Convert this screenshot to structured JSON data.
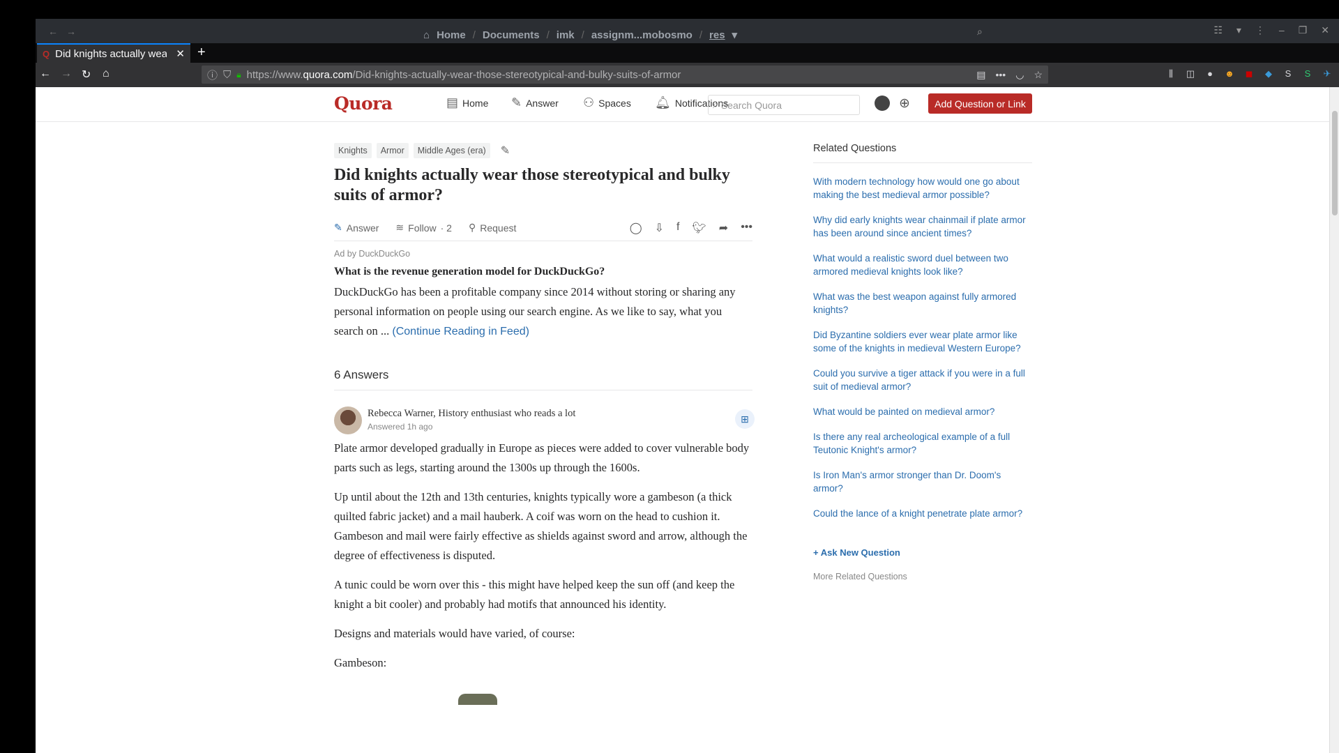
{
  "os_bar": {
    "crumbs": [
      "Home",
      "Documents",
      "imk",
      "assignm...mobosmo",
      "res"
    ]
  },
  "browser": {
    "tab_title": "Did knights actually wear those stereotypical and bulky suits of armor",
    "url_prefix": "https://www.",
    "url_domain": "quora.com",
    "url_path": "/Did-knights-actually-wear-those-stereotypical-and-bulky-suits-of-armor"
  },
  "header": {
    "logo": "Quora",
    "nav": [
      "Home",
      "Answer",
      "Spaces",
      "Notifications"
    ],
    "search_placeholder": "Search Quora",
    "add_button": "Add Question or Link"
  },
  "question": {
    "topics": [
      "Knights",
      "Armor",
      "Middle Ages (era)"
    ],
    "title": "Did knights actually wear those stereotypical and bulky suits of armor?",
    "answer_label": "Answer",
    "follow_label": "Follow",
    "follow_count": "· 2",
    "request_label": "Request"
  },
  "ad": {
    "by": "Ad by DuckDuckGo",
    "question": "What is the revenue generation model for DuckDuckGo?",
    "body": "DuckDuckGo has been a profitable company since 2014 without storing or sharing any personal information on people using our search engine. As we like to say, what you search on ... ",
    "link": "(Continue Reading in Feed)"
  },
  "answers": {
    "count_label": "6 Answers",
    "first": {
      "author": "Rebecca Warner, History enthusiast who reads a lot",
      "when": "Answered 1h ago",
      "paragraphs": [
        "Plate armor developed gradually in Europe as pieces were added to cover vulnerable body parts such as legs, starting around the 1300s up through the 1600s.",
        "Up until about the 12th and 13th centuries, knights typically wore a gambeson (a thick quilted fabric jacket) and a mail hauberk. A coif was worn on the head to cushion it. Gambeson and mail were fairly effective as shields against sword and arrow, although the degree of effectiveness is disputed.",
        "A tunic could be worn over this - this might have helped keep the sun off (and keep the knight a bit cooler) and probably had motifs that announced his identity.",
        "Designs and materials would have varied, of course:",
        "Gambeson:"
      ]
    }
  },
  "sidebar": {
    "title": "Related Questions",
    "questions": [
      "With modern technology how would one go about making the best medieval armor possible?",
      "Why did early knights wear chainmail if plate armor has been around since ancient times?",
      "What would a realistic sword duel between two armored medieval knights look like?",
      "What was the best weapon against fully armored knights?",
      "Did Byzantine soldiers ever wear plate armor like some of the knights in medieval Western Europe?",
      "Could you survive a tiger attack if you were in a full suit of medieval armor?",
      "What would be painted on medieval armor?",
      "Is there any real archeological example of a full Teutonic Knight's armor?",
      "Is Iron Man's armor stronger than Dr. Doom's armor?",
      "Could the lance of a knight penetrate plate armor?"
    ],
    "ask_new": "Ask New Question",
    "more": "More Related Questions"
  },
  "colors": {
    "brand": "#b92b27",
    "link": "#2b6dad"
  }
}
